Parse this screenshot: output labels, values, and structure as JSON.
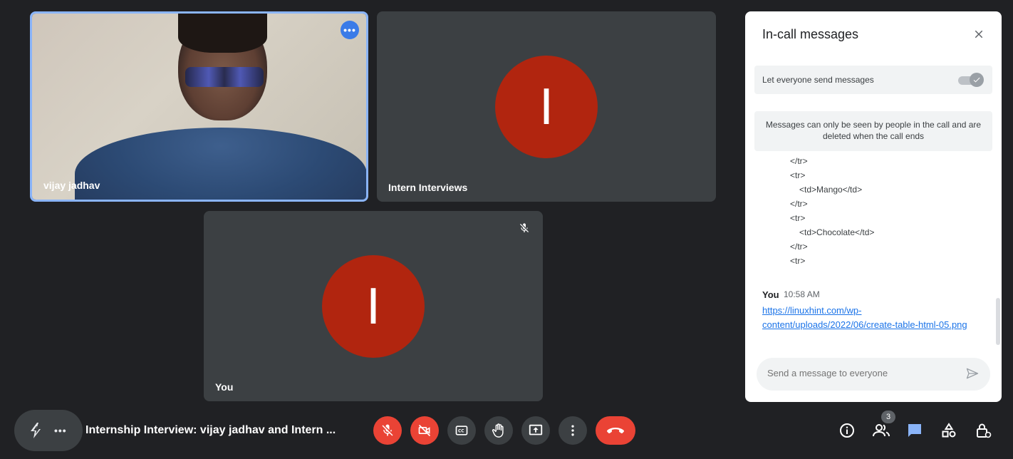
{
  "participants": [
    {
      "name": "vijay jadhav",
      "has_video": true
    },
    {
      "name": "Intern Interviews",
      "avatar_letter": "I",
      "avatar_color": "#b1250f"
    },
    {
      "name": "You",
      "avatar_letter": "I",
      "avatar_color": "#b1250f",
      "muted": true
    }
  ],
  "tile_menu_label": "•••",
  "chat": {
    "title": "In-call messages",
    "setting_label": "Let everyone send messages",
    "info": "Messages can only be seen by people in the call and are deleted when the call ends",
    "code_lines": [
      {
        "text": "</tr>",
        "indent": 1
      },
      {
        "text": "<tr>",
        "indent": 1
      },
      {
        "text": "<td>Mango</td>",
        "indent": 2
      },
      {
        "text": "</tr>",
        "indent": 1
      },
      {
        "text": "<tr>",
        "indent": 1
      },
      {
        "text": "<td>Chocolate</td>",
        "indent": 2
      },
      {
        "text": "</tr>",
        "indent": 1
      },
      {
        "text": "<tr>",
        "indent": 1
      }
    ],
    "message": {
      "sender": "You",
      "time": "10:58 AM",
      "link_line1": "https://linuxhint.com/wp-",
      "link_line2": "content/uploads/2022/06/create-table-html-05.png"
    },
    "composer_placeholder": "Send a message to everyone"
  },
  "meeting_title": "Internship Interview: vijay jadhav and Intern ...",
  "activity_more_label": "•••",
  "people_count": "3",
  "colors": {
    "background": "#202124",
    "tile": "#3c4043",
    "accent": "#8ab4f8",
    "danger": "#ea4335",
    "chat_active": "#8ab4f8"
  },
  "icons": {
    "mic": "mic-off-icon",
    "camera": "camera-off-icon",
    "captions": "captions-icon",
    "hand": "raise-hand-icon",
    "present": "present-screen-icon",
    "more": "more-vert-icon",
    "hangup": "call-end-icon",
    "info": "info-icon",
    "people": "people-icon",
    "chat": "chat-icon",
    "activities": "activities-icon",
    "host": "host-controls-icon"
  }
}
